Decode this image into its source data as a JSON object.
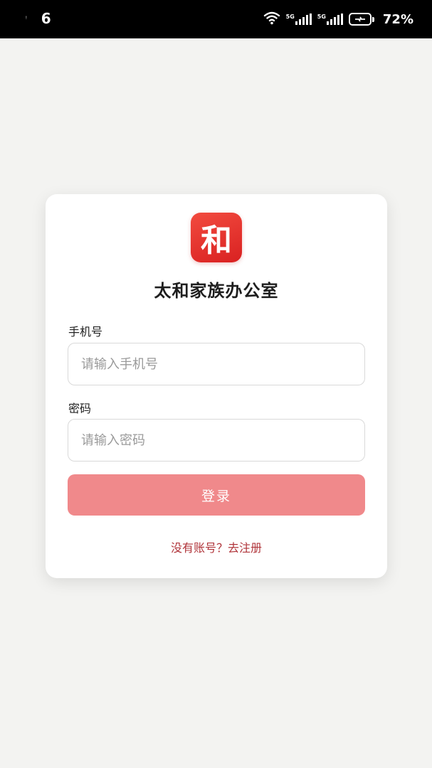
{
  "status_bar": {
    "left_dot": "ᵎ",
    "time_fragment": "6",
    "network_tag_1": "5G",
    "network_tag_2": "5G",
    "battery_percent": "72%",
    "icons": [
      "wifi-icon",
      "signal-5g-icon",
      "signal-5g-icon",
      "battery-charging-icon"
    ]
  },
  "app": {
    "logo_char": "和",
    "title": "太和家族办公室",
    "brand_color": "#e02b27"
  },
  "form": {
    "phone": {
      "label": "手机号",
      "placeholder": "请输入手机号",
      "value": ""
    },
    "password": {
      "label": "密码",
      "placeholder": "请输入密码",
      "value": ""
    },
    "login_label": "登录",
    "login_color": "#f0898b",
    "register_text": "没有账号？去注册",
    "register_color": "#b0343a"
  }
}
